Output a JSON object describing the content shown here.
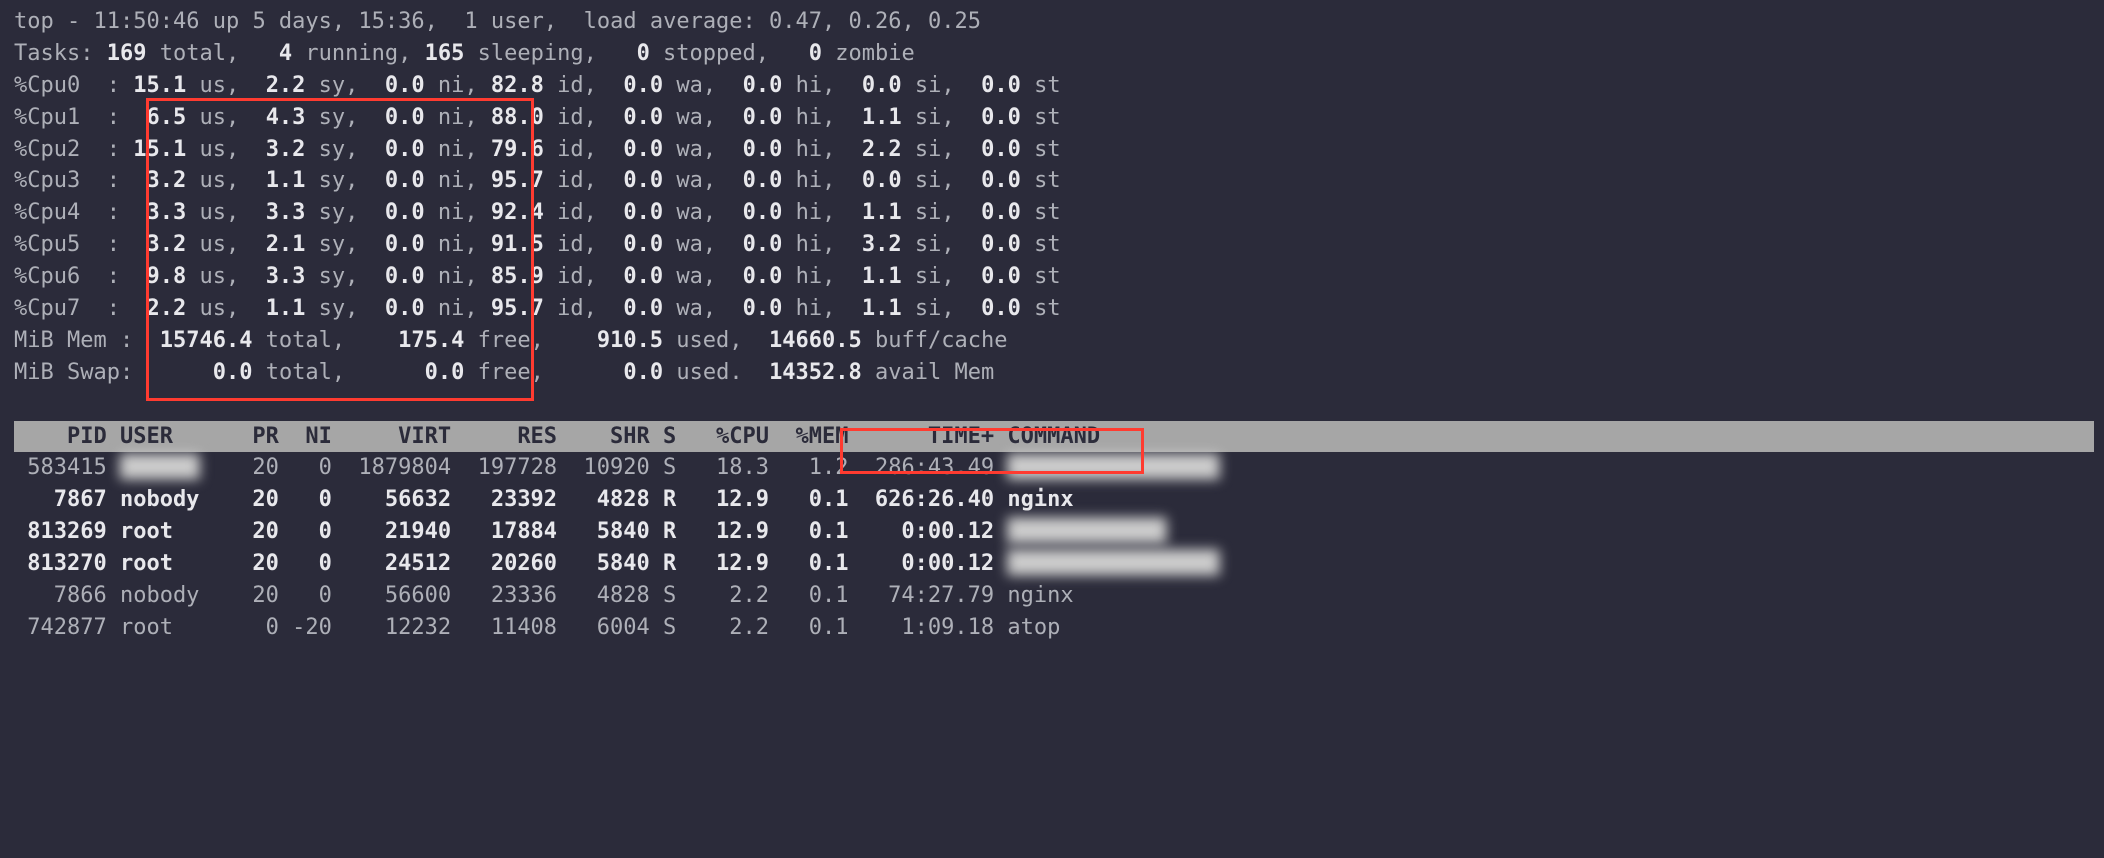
{
  "summary": {
    "time": "11:50:46",
    "uptime": "up 5 days, 15:36",
    "users": "1 user",
    "load": "load average: 0.47, 0.26, 0.25"
  },
  "tasks": {
    "total": "169",
    "running": "4",
    "sleeping": "165",
    "stopped": "0",
    "zombie": "0"
  },
  "cpus": [
    {
      "name": "%Cpu0",
      "us": "15.1",
      "sy": "2.2",
      "ni": "0.0",
      "id": "82.8",
      "wa": "0.0",
      "hi": "0.0",
      "si": "0.0",
      "st": "0.0"
    },
    {
      "name": "%Cpu1",
      "us": "6.5",
      "sy": "4.3",
      "ni": "0.0",
      "id": "88.0",
      "wa": "0.0",
      "hi": "0.0",
      "si": "1.1",
      "st": "0.0"
    },
    {
      "name": "%Cpu2",
      "us": "15.1",
      "sy": "3.2",
      "ni": "0.0",
      "id": "79.6",
      "wa": "0.0",
      "hi": "0.0",
      "si": "2.2",
      "st": "0.0"
    },
    {
      "name": "%Cpu3",
      "us": "3.2",
      "sy": "1.1",
      "ni": "0.0",
      "id": "95.7",
      "wa": "0.0",
      "hi": "0.0",
      "si": "0.0",
      "st": "0.0"
    },
    {
      "name": "%Cpu4",
      "us": "3.3",
      "sy": "3.3",
      "ni": "0.0",
      "id": "92.4",
      "wa": "0.0",
      "hi": "0.0",
      "si": "1.1",
      "st": "0.0"
    },
    {
      "name": "%Cpu5",
      "us": "3.2",
      "sy": "2.1",
      "ni": "0.0",
      "id": "91.5",
      "wa": "0.0",
      "hi": "0.0",
      "si": "3.2",
      "st": "0.0"
    },
    {
      "name": "%Cpu6",
      "us": "9.8",
      "sy": "3.3",
      "ni": "0.0",
      "id": "85.9",
      "wa": "0.0",
      "hi": "0.0",
      "si": "1.1",
      "st": "0.0"
    },
    {
      "name": "%Cpu7",
      "us": "2.2",
      "sy": "1.1",
      "ni": "0.0",
      "id": "95.7",
      "wa": "0.0",
      "hi": "0.0",
      "si": "1.1",
      "st": "0.0"
    }
  ],
  "mem": {
    "label": "MiB Mem :",
    "total": "15746.4",
    "free": "175.4",
    "used": "910.5",
    "buff": "14660.5"
  },
  "swap": {
    "label": "MiB Swap:",
    "total": "0.0",
    "free": "0.0",
    "used": "0.0",
    "avail": "14352.8"
  },
  "columns": [
    "PID",
    "USER",
    "PR",
    "NI",
    "VIRT",
    "RES",
    "SHR",
    "S",
    "%CPU",
    "%MEM",
    "TIME+",
    "COMMAND"
  ],
  "col_widths": {
    "PID": 7,
    "USER": 8,
    "PR": 3,
    "NI": 3,
    "VIRT": 8,
    "RES": 7,
    "SHR": 6,
    "S": 1,
    "CPU": 6,
    "MEM": 5,
    "TIME": 10,
    "CMD": 30
  },
  "processes": [
    {
      "pid": "583415",
      "user": "██████",
      "pr": "20",
      "ni": "0",
      "virt": "1879804",
      "res": "197728",
      "shr": "10920",
      "s": "S",
      "cpu": "18.3",
      "mem": "1.2",
      "time": "286:43.49",
      "cmd": "████████████████",
      "bold": false,
      "blurcmd": true,
      "bluruser": true
    },
    {
      "pid": "7867",
      "user": "nobody",
      "pr": "20",
      "ni": "0",
      "virt": "56632",
      "res": "23392",
      "shr": "4828",
      "s": "R",
      "cpu": "12.9",
      "mem": "0.1",
      "time": "626:26.40",
      "cmd": "nginx",
      "bold": true,
      "blurcmd": false,
      "bluruser": false
    },
    {
      "pid": "813269",
      "user": "root",
      "pr": "20",
      "ni": "0",
      "virt": "21940",
      "res": "17884",
      "shr": "5840",
      "s": "R",
      "cpu": "12.9",
      "mem": "0.1",
      "time": "0:00.12",
      "cmd": "████████████",
      "bold": true,
      "blurcmd": true,
      "bluruser": false
    },
    {
      "pid": "813270",
      "user": "root",
      "pr": "20",
      "ni": "0",
      "virt": "24512",
      "res": "20260",
      "shr": "5840",
      "s": "R",
      "cpu": "12.9",
      "mem": "0.1",
      "time": "0:00.12",
      "cmd": "████████████████",
      "bold": true,
      "blurcmd": true,
      "bluruser": false
    },
    {
      "pid": "7866",
      "user": "nobody",
      "pr": "20",
      "ni": "0",
      "virt": "56600",
      "res": "23336",
      "shr": "4828",
      "s": "S",
      "cpu": "2.2",
      "mem": "0.1",
      "time": "74:27.79",
      "cmd": "nginx",
      "bold": false,
      "blurcmd": false,
      "bluruser": false
    },
    {
      "pid": "742877",
      "user": "root",
      "pr": "0",
      "ni": "-20",
      "virt": "12232",
      "res": "11408",
      "shr": "6004",
      "s": "S",
      "cpu": "2.2",
      "mem": "0.1",
      "time": "1:09.18",
      "cmd": "atop",
      "bold": false,
      "blurcmd": false,
      "bluruser": false
    }
  ]
}
